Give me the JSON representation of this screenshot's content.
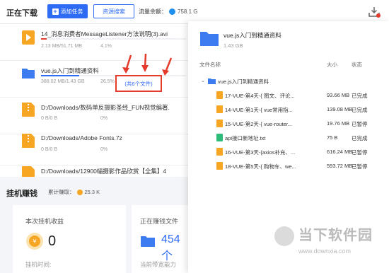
{
  "header": {
    "title": "正在下载",
    "add_task_label": "添加任务",
    "resource_search_label": "资源搜索",
    "flow_label": "流量余额：",
    "flow_value": "758.1 G"
  },
  "tasks": [
    {
      "name": "14_消息消费者MessageListener方法说明(3).avi",
      "meta": "2.13 MB/51.71 MB",
      "pct": "4.1%",
      "type": "video",
      "progress": 0.041,
      "bar_color": "#e53b2c"
    },
    {
      "name": "vue.js入门到精通资料",
      "meta": "388.02 MB/1.43 GB",
      "pct": "26.5%",
      "type": "folder",
      "progress": 0.265,
      "bar_color": "#2e6cf6"
    },
    {
      "name": "D:/Downloads/数码单反摄影圣经_FUN视觉编著.",
      "meta": "0 B/0 B",
      "pct": "0%",
      "type": "zip",
      "progress": 0,
      "bar_color": "#2e6cf6"
    },
    {
      "name": "D:/Downloads/Adobe Fonts.7z",
      "meta": "0 B/0 B",
      "pct": "0%",
      "type": "zip",
      "progress": 0,
      "bar_color": "#2e6cf6"
    },
    {
      "name": "D:/Downloads/12900幅摄影作品欣赏【全集】4",
      "meta": "",
      "pct": "",
      "type": "zip",
      "progress": 0,
      "bar_color": "#2e6cf6"
    }
  ],
  "annotation": {
    "label": "(共6个文件)"
  },
  "earnings": {
    "title": "挂机赚钱",
    "total_label": "累计赚取：",
    "total_value": "25.3 K",
    "card1_label": "本次挂机收益",
    "card1_value": "0",
    "card1_sub": "挂机时间:",
    "card2_label": "正在赚钱文件",
    "card2_value": "454个",
    "card2_sub": "当前带宽能力"
  },
  "detail": {
    "name": "vue.js入门到精通资料",
    "size": "1.43 GB",
    "col_name": "文件名称",
    "col_size": "大小",
    "col_status": "状态",
    "root_name": "vue.js入门到精通资料",
    "files": [
      {
        "name": "17-VUE-第4天-{ 图文、评论...",
        "size": "93.66 MB",
        "status": "已完成",
        "color": "#f6a623"
      },
      {
        "name": "14-VUE-第1天-{ vue常用指...",
        "size": "139.08 MB",
        "status": "已完成",
        "color": "#f6a623"
      },
      {
        "name": "15-VUE-第2天-{ vue-router...",
        "size": "19.76 MB",
        "status": "已暂停",
        "color": "#f6a623"
      },
      {
        "name": "api接口新地址.txt",
        "size": "75 B",
        "status": "已完成",
        "color": "#2dbb7a"
      },
      {
        "name": "16-VUE-第3天-{axios补充、...",
        "size": "616.24 MB",
        "status": "已暂停",
        "color": "#f6a623"
      },
      {
        "name": "18-VUE-第5天-{ 购物车、we...",
        "size": "593.72 MB",
        "status": "已暂停",
        "color": "#f6a623"
      }
    ]
  },
  "watermark": {
    "title": "当下软件园",
    "url": "www.downxia.com"
  }
}
